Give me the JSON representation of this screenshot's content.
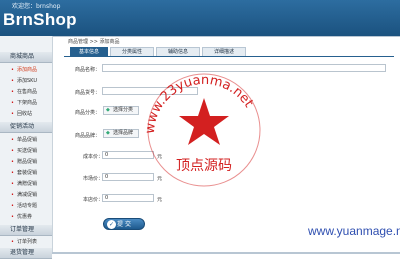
{
  "header": {
    "welcome": "欢迎您：brnshop",
    "logo": "BrnShop"
  },
  "sidebar": {
    "sections": [
      {
        "title": "商城商品",
        "items": [
          "添加商品",
          "添加SKU",
          "在售商品",
          "下架商品",
          "回收站"
        ]
      },
      {
        "title": "促销活动",
        "items": [
          "单品促销",
          "买送促销",
          "赠品促销",
          "套装促销",
          "满赠促销",
          "满减促销",
          "活动专题",
          "优惠券"
        ]
      },
      {
        "title": "订单管理",
        "items": [
          "订单列表"
        ]
      },
      {
        "title": "退货管理",
        "items": []
      }
    ],
    "active_item": "添加商品"
  },
  "breadcrumb": "商品管理 >> 添加商品",
  "tabs": [
    "基本信息",
    "分类属性",
    "辅助信息",
    "详细描述"
  ],
  "active_tab": "基本信息",
  "form": {
    "name_label": "商品名称：",
    "sn_label": "商品货号：",
    "category_label": "商品分类：",
    "category_button": "选择分类",
    "brand_label": "商品品牌：",
    "brand_button": "选择品牌",
    "cost_label": "成本价：",
    "cost_value": "0",
    "market_label": "市场价：",
    "market_value": "0",
    "shop_label": "本店价：",
    "shop_value": "0",
    "unit": "元",
    "submit": "提 交"
  },
  "watermarks": {
    "stamp_url": "www.23yuanma.net",
    "stamp_text": "顶点源码",
    "footer_url": "www.yuanmage.net",
    "colors": {
      "stamp": "#d32020",
      "footer": "#2f4fb0"
    }
  },
  "colors": {
    "header": "#1b527f",
    "accent": "#26608f",
    "active_link": "#d23a1a"
  }
}
